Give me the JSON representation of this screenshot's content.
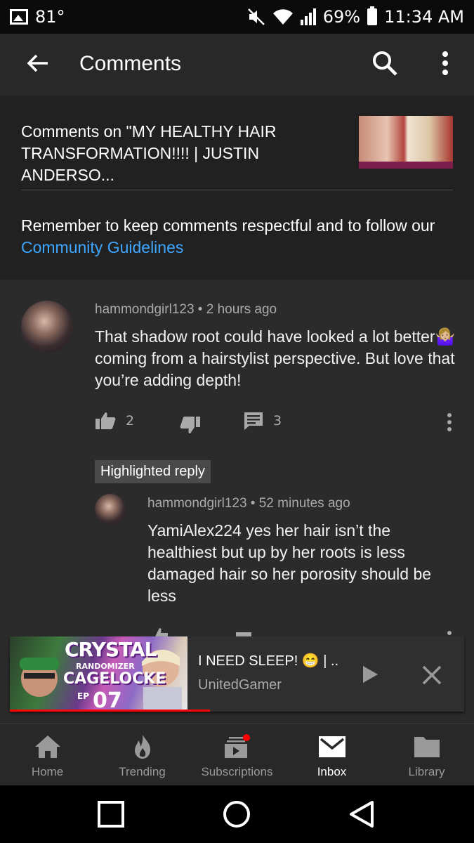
{
  "status_bar": {
    "temperature": "81°",
    "battery": "69%",
    "time": "11:34 AM"
  },
  "app_bar": {
    "title": "Comments"
  },
  "header": {
    "video_title": "Comments on \"MY HEALTHY HAIR TRANSFORMATION!!!! | JUSTIN ANDERSO...",
    "reminder_prefix": "Remember to keep comments respectful and to follow our ",
    "reminder_link": "Community Guidelines"
  },
  "comment": {
    "author_meta": "hammondgirl123 • 2 hours ago",
    "text": "That shadow root could have looked a lot better🤷🏼‍♀️ coming from a hairstylist perspective. But love that you’re adding depth!",
    "likes": "2",
    "replies": "3"
  },
  "highlighted_label": "Highlighted reply",
  "reply": {
    "author_meta": "hammondgirl123 • 52 minutes ago",
    "text": "YamiAlex224 yes her hair isn’t the healthiest but up by her roots is less damaged hair so her porosity should be less"
  },
  "mini_player": {
    "title": "I NEED SLEEP! 😁 | ..",
    "channel": "UnitedGamer",
    "thumb_text": {
      "line1": "CRYSTAL",
      "line2": "RANDOMIZER",
      "line3": "CAGELOCKE",
      "ep": "EP",
      "num": "07"
    },
    "progress": 0.44
  },
  "bottom_nav": {
    "items": [
      {
        "label": "Home",
        "icon": "home-icon"
      },
      {
        "label": "Trending",
        "icon": "flame-icon"
      },
      {
        "label": "Subscriptions",
        "icon": "subscriptions-icon"
      },
      {
        "label": "Inbox",
        "icon": "inbox-icon",
        "active": true
      },
      {
        "label": "Library",
        "icon": "folder-icon"
      }
    ]
  },
  "colors": {
    "link": "#3ea6ff",
    "progress": "#ff0000",
    "notification_dot": "#ff0000"
  }
}
